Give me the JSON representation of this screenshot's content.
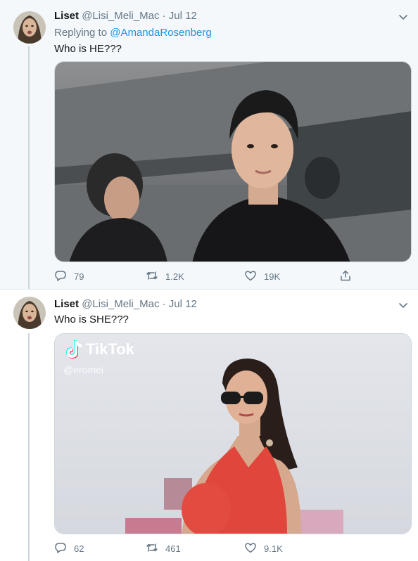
{
  "tweets": [
    {
      "name": "Liset",
      "handle": "@Lisi_Meli_Mac",
      "sep": "·",
      "date": "Jul 12",
      "replying_prefix": "Replying to",
      "replying_to": "@AmandaRosenberg",
      "text": "Who is HE???",
      "replies": "79",
      "retweets": "1.2K",
      "likes": "19K"
    },
    {
      "name": "Liset",
      "handle": "@Lisi_Meli_Mac",
      "sep": "·",
      "date": "Jul 12",
      "text": "Who is SHE???",
      "replies": "62",
      "retweets": "461",
      "likes": "9.1K",
      "media_watermark": "TikTok",
      "media_user": "@eromei"
    }
  ],
  "icons": [
    "chevron-down-icon",
    "reply-icon",
    "retweet-icon",
    "like-icon",
    "share-icon"
  ],
  "colors": {
    "link": "#1b95e0",
    "secondary_text": "#657786",
    "selected_bg": "#f5f8fa"
  }
}
